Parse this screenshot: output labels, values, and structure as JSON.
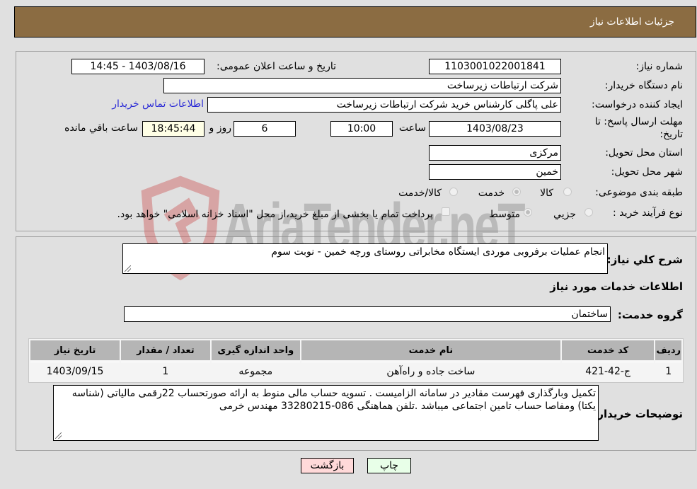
{
  "header": {
    "title": "جزئیات اطلاعات نیاز"
  },
  "form": {
    "need_number": {
      "label": "شماره نیاز:",
      "value": "1103001022001841"
    },
    "announce_datetime": {
      "label": "تاریخ و ساعت اعلان عمومی:",
      "value": "1403/08/16 - 14:45"
    },
    "buyer_org": {
      "label": "نام دستگاه خریدار:",
      "value": "شرکت ارتباطات زیرساخت"
    },
    "requester": {
      "label": "ایجاد کننده درخواست:",
      "value": "علی پاگلی کارشناس خرید شرکت ارتباطات زیرساخت"
    },
    "buyer_contact_link": "اطلاعات تماس خریدار",
    "deadline": {
      "label_line1": "مهلت ارسال پاسخ: تا",
      "label_line2": "تاریخ:",
      "date": "1403/08/23",
      "time_label": "ساعت",
      "time": "10:00",
      "days": "6",
      "days_label": "روز و",
      "remaining": "18:45:44",
      "remaining_label": "ساعت باقي مانده"
    },
    "province": {
      "label": "استان محل تحویل:",
      "value": "مرکزی"
    },
    "city": {
      "label": "شهر محل تحویل:",
      "value": "خمین"
    },
    "category": {
      "label": "طبقه بندی موضوعی:",
      "options": [
        {
          "label": "کالا",
          "checked": false
        },
        {
          "label": "خدمت",
          "checked": true
        },
        {
          "label": "کالا/خدمت",
          "checked": false
        }
      ]
    },
    "process_type": {
      "label": "نوع فرآیند خرید :",
      "options": [
        {
          "label": "جزيي",
          "checked": false
        },
        {
          "label": "متوسط",
          "checked": true
        }
      ],
      "treasury_checkbox_label": "پرداخت تمام یا بخشی از مبلغ خرید،از محل \"اسناد خزانه اسلامی\" خواهد بود."
    }
  },
  "details": {
    "description_label": "شرح كلي نياز:",
    "description": "انجام عملیات برفروبی موردی ایستگاه مخابراتی روستای ورچه خمین - نوبت سوم",
    "services_heading": "اطلاعات خدمات مورد نیاز",
    "service_group_label": "گروه خدمت:",
    "service_group": "ساختمان",
    "table": {
      "headers": [
        "ردیف",
        "کد خدمت",
        "نام خدمت",
        "واحد اندازه گیری",
        "تعداد / مقدار",
        "تاریخ نیاز"
      ],
      "rows": [
        [
          "1",
          "ج-42-421",
          "ساخت جاده و راه‌آهن",
          "مجموعه",
          "1",
          "1403/09/15"
        ]
      ]
    },
    "buyer_notes_label": "توضیحات خریدار:",
    "buyer_notes": "تکمیل وبارگذاری فهرست مقادیر در سامانه الزامیست . تسویه حساب مالی منوط به ارائه صورتحساب 22رقمی مالیاتی (شناسه یکتا) ومفاصا حساب تامین اجتماعی میباشد .تلفن هماهنگی 086-33280215 مهندس خرمی"
  },
  "buttons": {
    "print": "چاپ",
    "back": "بازگشت"
  },
  "watermark": {
    "text": "AriaTender.neT"
  },
  "colors": {
    "header_bg": "#8b6c42",
    "link": "#2b2bd6",
    "back_btn": "#ffd9d9",
    "print_btn": "#e8ffe8"
  }
}
